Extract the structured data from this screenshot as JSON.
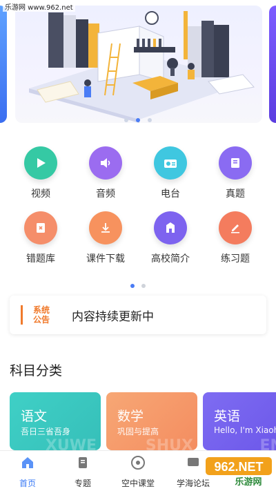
{
  "watermark": "乐游网 www.962.net",
  "grid": {
    "row1": [
      {
        "label": "视频",
        "color": "#35c9a4"
      },
      {
        "label": "音频",
        "color": "#9b6cf0"
      },
      {
        "label": "电台",
        "color": "#3fc7e0"
      },
      {
        "label": "真题",
        "color": "#8a6bf2"
      }
    ],
    "row2": [
      {
        "label": "错题库",
        "color": "#f58e6a"
      },
      {
        "label": "课件下载",
        "color": "#f7925e"
      },
      {
        "label": "高校简介",
        "color": "#7d63ef"
      },
      {
        "label": "练习题",
        "color": "#f47c5e"
      }
    ]
  },
  "notice": {
    "tag_line1": "系统",
    "tag_line2": "公告",
    "text": "内容持续更新中"
  },
  "section_title": "科目分类",
  "cards": [
    {
      "title": "语文",
      "subtitle": "吾日三省吾身",
      "bg": "#3fcbc0",
      "mark": "XUWE"
    },
    {
      "title": "数学",
      "subtitle": "巩固与提高",
      "bg": "#f59a6a",
      "mark": "SHUX"
    },
    {
      "title": "英语",
      "subtitle": "Hello, I'm Xiaohong",
      "bg": "#7a64ef",
      "mark": "ENG"
    }
  ],
  "tabs": [
    {
      "label": "首页",
      "active": true
    },
    {
      "label": "专题"
    },
    {
      "label": "空中课堂"
    },
    {
      "label": "学海论坛"
    }
  ],
  "corner_logo_text": "962.NET",
  "corner_logo_sub": "乐游网",
  "colors": {
    "accent": "#3b7bf6",
    "notice": "#f07a2c"
  }
}
